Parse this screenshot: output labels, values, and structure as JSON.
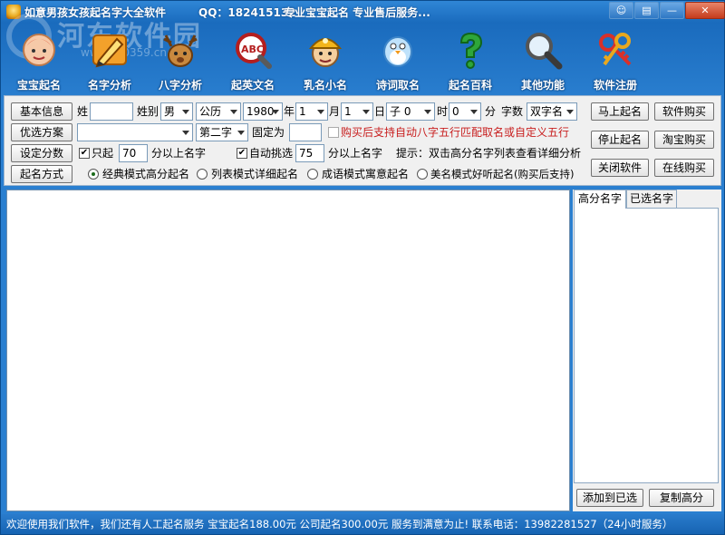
{
  "titlebar": {
    "title": "如意男孩女孩起名字大全软件",
    "qq": "QQ：182415132",
    "slogan": "专业宝宝起名  专业售后服务...",
    "buttons": {
      "skin": "☺",
      "menu": "▤",
      "minimize": "—",
      "close": "✕"
    }
  },
  "watermark": {
    "text": "河东软件园",
    "url": "www.pc0359.cn"
  },
  "toolbar": [
    {
      "label": "宝宝起名",
      "icon": "baby-icon"
    },
    {
      "label": "名字分析",
      "icon": "pencil-icon"
    },
    {
      "label": "八字分析",
      "icon": "deer-icon"
    },
    {
      "label": "起英文名",
      "icon": "abc-magnifier-icon"
    },
    {
      "label": "乳名小名",
      "icon": "miner-icon"
    },
    {
      "label": "诗词取名",
      "icon": "bird-icon"
    },
    {
      "label": "起名百科",
      "icon": "question-icon"
    },
    {
      "label": "其他功能",
      "icon": "magnifier-icon"
    },
    {
      "label": "软件注册",
      "icon": "keys-icon"
    }
  ],
  "form": {
    "basic_info_btn": "基本信息",
    "surname_label": "姓",
    "surname_value": "",
    "gender_label": "姓别",
    "gender_value": "男",
    "calendar_value": "公历",
    "year_value": "1980",
    "year_label": "年",
    "month_value": "1",
    "month_label": "月",
    "day_value": "1",
    "day_label": "日",
    "hour_value": "子 0",
    "hour_label": "时",
    "minute_value": "0",
    "minute_label": "分",
    "char_count_label": "字数",
    "char_count_value": "双字名",
    "preferred_btn": "优选方案",
    "preferred_value": "",
    "position_value": "第二字",
    "fixed_label": "固定为",
    "fixed_value": "",
    "bazi_checkbox_label": "购买后支持自动八字五行匹配取名或自定义五行",
    "score_btn": "设定分数",
    "only_start_label": "只起",
    "only_start_value": "70",
    "above_label_1": "分以上名字",
    "auto_pick_label": "自动挑选",
    "auto_pick_value": "75",
    "above_label_2": "分以上名字",
    "hint": "提示：双击高分名字列表查看详细分析",
    "mode_btn": "起名方式",
    "modes": [
      "经典模式高分起名",
      "列表模式详细起名",
      "成语模式寓意起名",
      "美名模式好听起名(购买后支持)"
    ]
  },
  "right_buttons": {
    "start": "马上起名",
    "buy": "软件购买",
    "stop": "停止起名",
    "taobao": "淘宝购买",
    "close_app": "关闭软件",
    "online_buy": "在线购买"
  },
  "side": {
    "tabs": [
      "高分名字",
      "已选名字"
    ],
    "add_btn": "添加到已选",
    "copy_btn": "复制高分"
  },
  "status": "欢迎使用我们软件，我们还有人工起名服务  宝宝起名188.00元  公司起名300.00元  服务到满意为止!   联系电话：13982281527（24小时服务）",
  "colors": {
    "title_bar": "#1a6bbd",
    "status_bar": "#1663b2",
    "warning_text": "#c81e1e"
  }
}
